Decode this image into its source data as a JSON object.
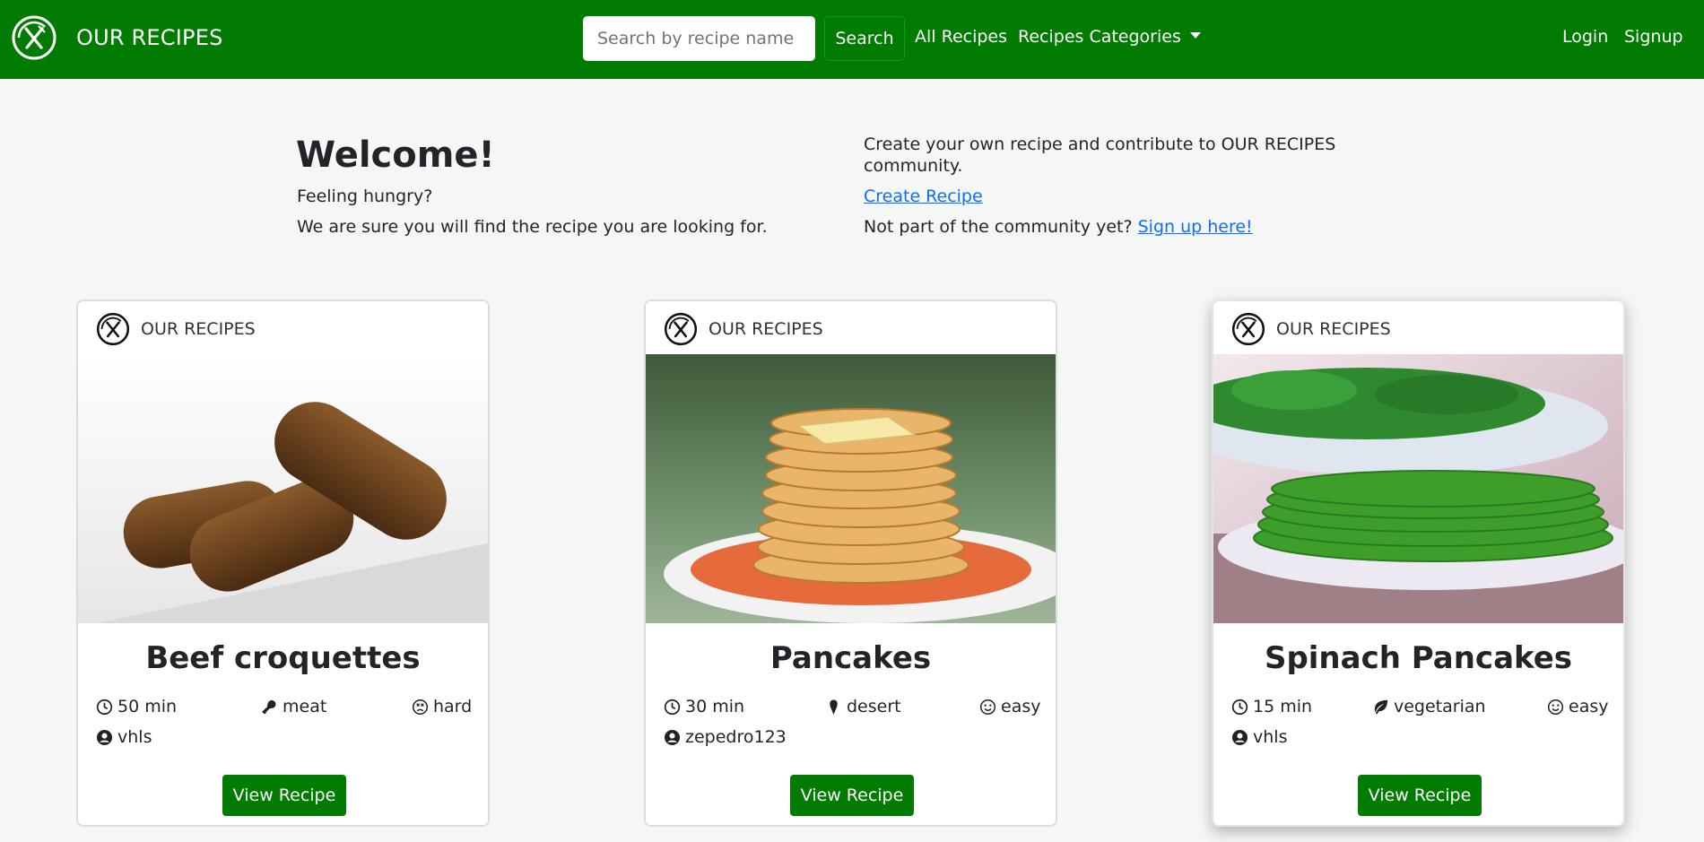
{
  "nav": {
    "brand": "OUR RECIPES",
    "search_placeholder": "Search by recipe name",
    "search_button": "Search",
    "all_recipes": "All Recipes",
    "categories": "Recipes Categories",
    "login": "Login",
    "signup": "Signup",
    "bg_color": "#017b01"
  },
  "hero": {
    "welcome": "Welcome!",
    "hungry": "Feeling hungry?",
    "sure": "We are sure you will find the recipe you are looking for.",
    "contribute_1": "Create your own recipe and contribute to OUR RECIPES",
    "contribute_2": "community.",
    "create_link": "Create Recipe",
    "not_part": "Not part of the community yet?",
    "signup_link": "Sign up here!"
  },
  "cards": [
    {
      "brand": "OUR RECIPES",
      "title": "Beef croquettes",
      "time": "50 min",
      "category": "meat",
      "category_icon": "drumstick-icon",
      "difficulty": "hard",
      "difficulty_icon": "frown-icon",
      "author": "vhls",
      "button": "View Recipe"
    },
    {
      "brand": "OUR RECIPES",
      "title": "Pancakes",
      "time": "30 min",
      "category": "desert",
      "category_icon": "ice-cream-icon",
      "difficulty": "easy",
      "difficulty_icon": "smile-icon",
      "author": "zepedro123",
      "button": "View Recipe"
    },
    {
      "brand": "OUR RECIPES",
      "title": "Spinach Pancakes",
      "time": "15 min",
      "category": "vegetarian",
      "category_icon": "leaf-icon",
      "difficulty": "easy",
      "difficulty_icon": "smile-icon",
      "author": "vhls",
      "button": "View Recipe"
    }
  ]
}
